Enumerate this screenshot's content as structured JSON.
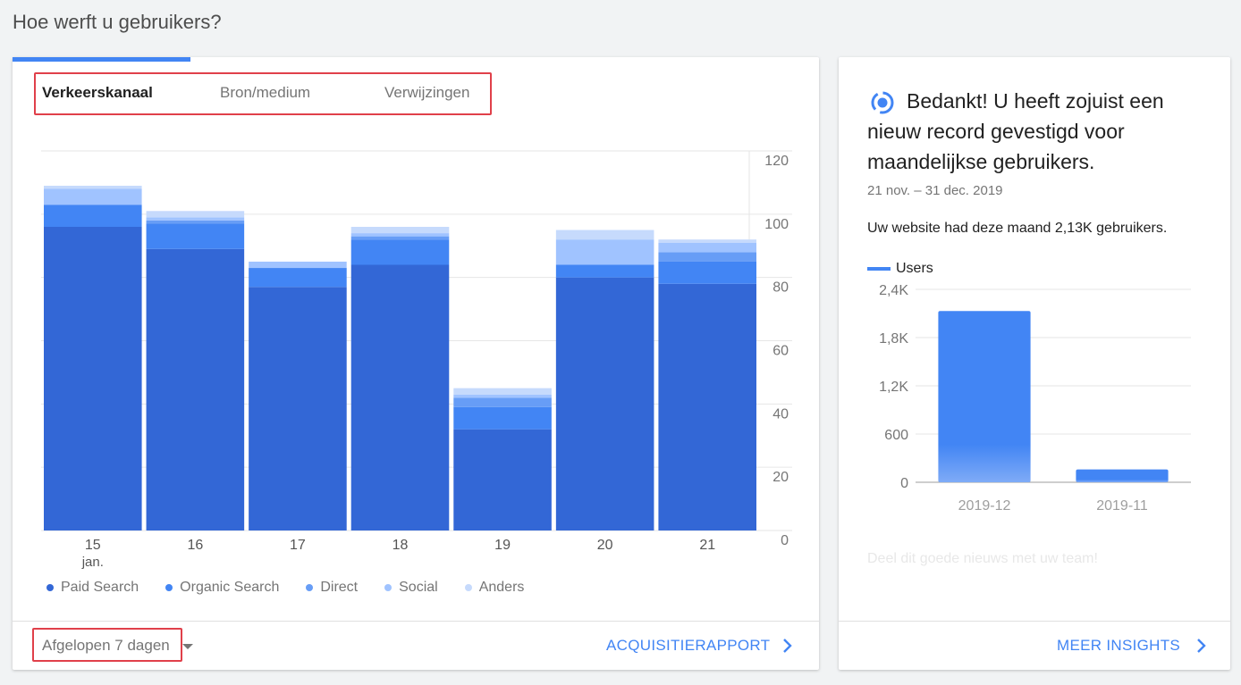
{
  "page": {
    "title": "Hoe werft u gebruikers?"
  },
  "acquisition": {
    "tabs": [
      {
        "label": "Verkeerskanaal",
        "active": true
      },
      {
        "label": "Bron/medium",
        "active": false
      },
      {
        "label": "Verwijzingen",
        "active": false
      }
    ],
    "range_label": "Afgelopen 7 dagen",
    "report_link": "ACQUISITIERAPPORT"
  },
  "insight": {
    "title": "Bedankt! U heeft zojuist een nieuw record gevestigd voor maandelijkse gebruikers.",
    "date_range": "21 nov. – 31 dec. 2019",
    "summary": "Uw website had deze maand 2,13K gebruikers.",
    "link": "MEER INSIGHTS",
    "share_text": "Deel dit goede nieuws met uw team!"
  },
  "colors": {
    "accent": "#4285f4",
    "paid_search": "#3367d6",
    "organic_search": "#4285f4",
    "direct": "#679df6",
    "social": "#a0c3ff",
    "anders": "#c6dafc",
    "highlight_border": "#e0404a"
  },
  "icons": {
    "insight": "insight-icon",
    "chevron": "chevron-right-icon",
    "dropdown": "caret-down-icon"
  },
  "chart_data": [
    {
      "type": "bar",
      "stacked": true,
      "categories": [
        "15",
        "16",
        "17",
        "18",
        "19",
        "20",
        "21"
      ],
      "category_sublabels": [
        "jan.",
        "",
        "",
        "",
        "",
        "",
        ""
      ],
      "series": [
        {
          "name": "Paid Search",
          "color": "#3367d6",
          "values": [
            96,
            89,
            77,
            84,
            32,
            80,
            78
          ]
        },
        {
          "name": "Organic Search",
          "color": "#4285f4",
          "values": [
            7,
            8,
            6,
            8,
            7,
            4,
            7
          ]
        },
        {
          "name": "Direct",
          "color": "#679df6",
          "values": [
            0,
            1,
            0,
            1,
            3,
            0,
            3
          ]
        },
        {
          "name": "Social",
          "color": "#a0c3ff",
          "values": [
            5,
            1,
            2,
            1,
            1,
            8,
            3
          ]
        },
        {
          "name": "Anders",
          "color": "#c6dafc",
          "values": [
            1,
            2,
            0,
            2,
            2,
            3,
            1
          ]
        }
      ],
      "yticks": [
        "120",
        "100",
        "80",
        "60",
        "40",
        "20",
        "0"
      ],
      "ylim": [
        0,
        120
      ],
      "legend_position": "bottom",
      "grid": true
    },
    {
      "type": "bar",
      "categories": [
        "2019-12",
        "2019-11"
      ],
      "series": [
        {
          "name": "Users",
          "color": "#4285f4",
          "values": [
            2130,
            160
          ]
        }
      ],
      "yticks": [
        "2,4K",
        "1,8K",
        "1,2K",
        "600",
        "0"
      ],
      "ylim": [
        0,
        2400
      ],
      "legend_position": "top-left",
      "grid": true
    }
  ]
}
